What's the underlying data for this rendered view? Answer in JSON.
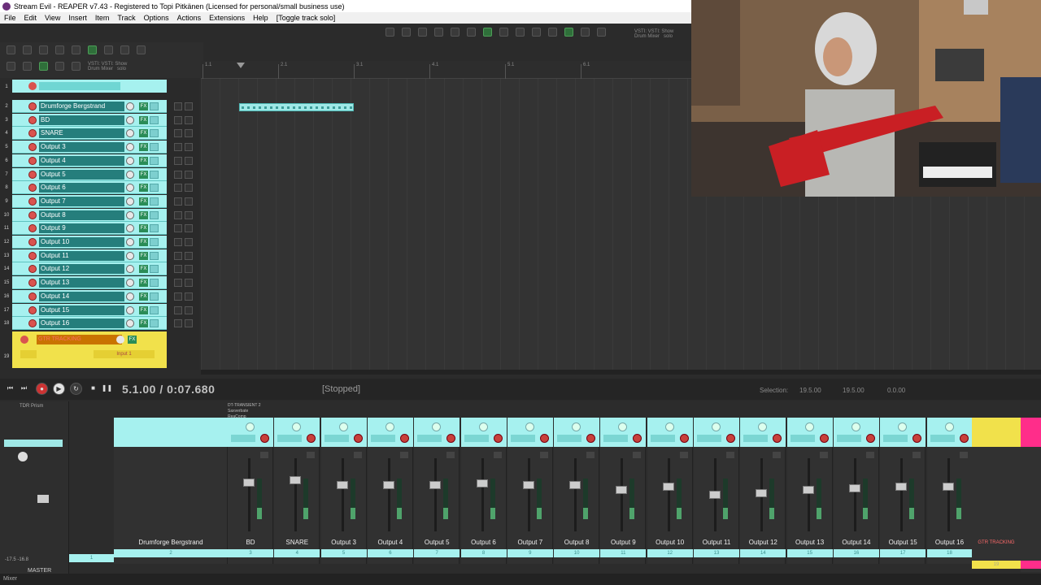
{
  "window": {
    "title": "Stream Evil - REAPER v7.43 - Registered to Topi Pitkänen (Licensed for personal/small business use)"
  },
  "menu": [
    "File",
    "Edit",
    "View",
    "Insert",
    "Item",
    "Track",
    "Options",
    "Actions",
    "Extensions",
    "Help",
    "[Toggle track solo]"
  ],
  "toolbar": {
    "label_left": "VSTI: VSTI: Show\nDrum Mixer   solo",
    "label_top": "VSTI: VSTI: Show\nDrum Mixer   solo"
  },
  "tracks": [
    {
      "num": "2",
      "name": "Drumforge Bergstrand"
    },
    {
      "num": "3",
      "name": "BD"
    },
    {
      "num": "4",
      "name": "SNARE"
    },
    {
      "num": "5",
      "name": "Output 3"
    },
    {
      "num": "6",
      "name": "Output 4"
    },
    {
      "num": "7",
      "name": "Output 5"
    },
    {
      "num": "8",
      "name": "Output 6"
    },
    {
      "num": "9",
      "name": "Output 7"
    },
    {
      "num": "10",
      "name": "Output 8"
    },
    {
      "num": "11",
      "name": "Output 9"
    },
    {
      "num": "12",
      "name": "Output 10"
    },
    {
      "num": "13",
      "name": "Output 11"
    },
    {
      "num": "14",
      "name": "Output 12"
    },
    {
      "num": "15",
      "name": "Output 13"
    },
    {
      "num": "16",
      "name": "Output 14"
    },
    {
      "num": "17",
      "name": "Output 15"
    },
    {
      "num": "18",
      "name": "Output 16"
    }
  ],
  "folder_track": {
    "num": "1"
  },
  "gtr_track": {
    "num": "19",
    "name": "GTR TRACKING",
    "input": "Input 1",
    "fx": "FX"
  },
  "fx_label": "FX",
  "ruler": [
    "1.1",
    "2.1",
    "3.1",
    "4.1",
    "5.1",
    "6.1"
  ],
  "transport": {
    "time": "5.1.00 / 0:07.680",
    "status": "[Stopped]",
    "selection_label": "Selection:",
    "sel_start": "19.5.00",
    "sel_end": "19.5.00",
    "sel_len": "0.0.00"
  },
  "mixer": {
    "master_label": "MASTER",
    "tdr_label": "TDR Prism",
    "master_vu": "-17.5  -16.8",
    "master_num": "1",
    "drumforge_name": "Drumforge Bergstrand",
    "drumforge_num": "2",
    "bd_fx": [
      "DT-TRANSIENT 2",
      "Saxverbate",
      "ReaComp"
    ],
    "strips": [
      {
        "name": "BD",
        "num": "3"
      },
      {
        "name": "SNARE",
        "num": "4"
      },
      {
        "name": "Output 3",
        "num": "5"
      },
      {
        "name": "Output 4",
        "num": "6"
      },
      {
        "name": "Output 5",
        "num": "7"
      },
      {
        "name": "Output 6",
        "num": "8"
      },
      {
        "name": "Output 7",
        "num": "9"
      },
      {
        "name": "Output 8",
        "num": "10"
      },
      {
        "name": "Output 9",
        "num": "11"
      },
      {
        "name": "Output 10",
        "num": "12"
      },
      {
        "name": "Output 11",
        "num": "13"
      },
      {
        "name": "Output 12",
        "num": "14"
      },
      {
        "name": "Output 13",
        "num": "15"
      },
      {
        "name": "Output 14",
        "num": "16"
      },
      {
        "name": "Output 15",
        "num": "17"
      },
      {
        "name": "Output 16",
        "num": "18"
      }
    ],
    "gtr_name": "GTR TRACKING",
    "gtr_num": "19",
    "footer": "Mixer"
  },
  "colors": {
    "track_cyan": "#a6f1ef",
    "track_name_teal": "#257e7c",
    "gtr_yellow": "#f1e14b",
    "record_red": "#d9534f",
    "pink": "#ff2d8a"
  },
  "icons": [
    "app-icon",
    "record-icon",
    "play-icon",
    "stop-icon",
    "pause-icon",
    "loop-icon",
    "rewind-icon",
    "forward-icon"
  ]
}
